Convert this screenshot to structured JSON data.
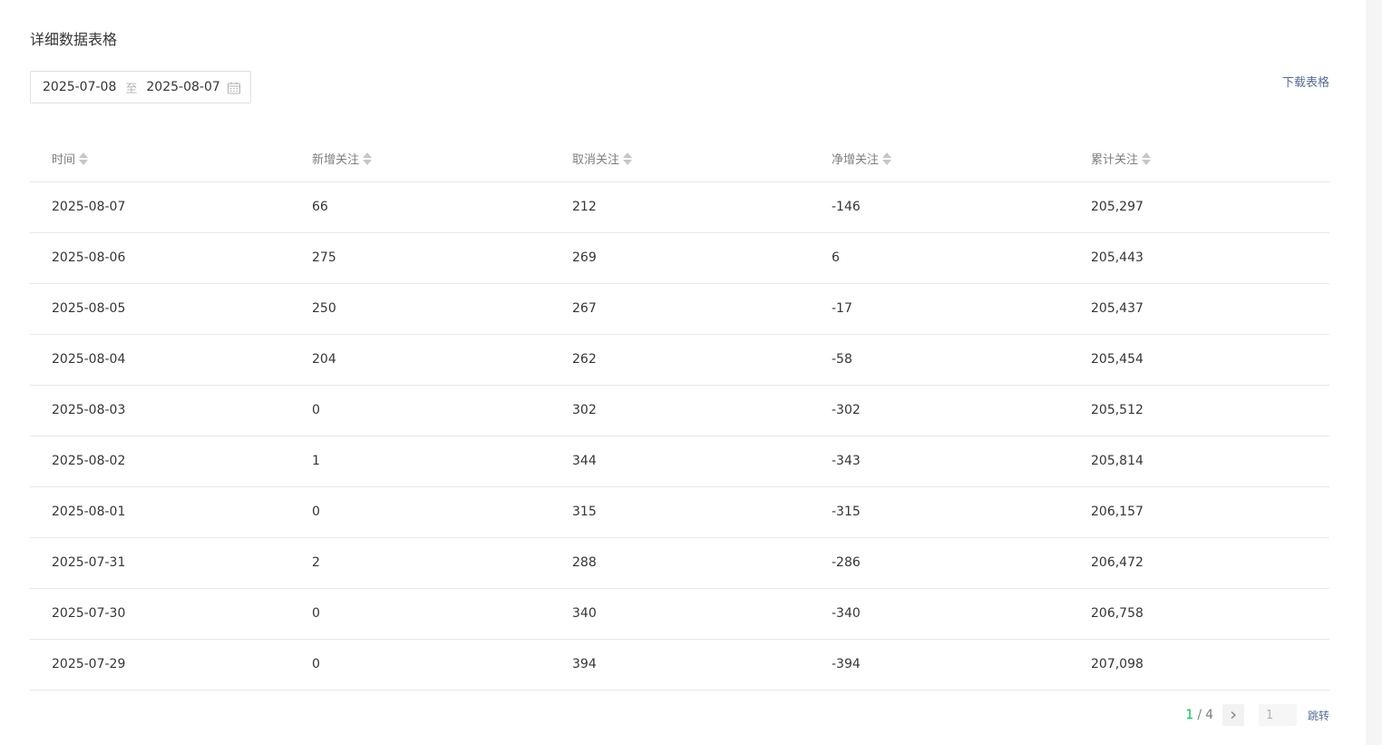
{
  "section": {
    "title": "详细数据表格"
  },
  "date_range": {
    "start": "2025-07-08",
    "separator": "至",
    "end": "2025-08-07"
  },
  "download_label": "下载表格",
  "table": {
    "columns": [
      "时间",
      "新增关注",
      "取消关注",
      "净增关注",
      "累计关注"
    ],
    "rows": [
      [
        "2025-08-07",
        "66",
        "212",
        "-146",
        "205,297"
      ],
      [
        "2025-08-06",
        "275",
        "269",
        "6",
        "205,443"
      ],
      [
        "2025-08-05",
        "250",
        "267",
        "-17",
        "205,437"
      ],
      [
        "2025-08-04",
        "204",
        "262",
        "-58",
        "205,454"
      ],
      [
        "2025-08-03",
        "0",
        "302",
        "-302",
        "205,512"
      ],
      [
        "2025-08-02",
        "1",
        "344",
        "-343",
        "205,814"
      ],
      [
        "2025-08-01",
        "0",
        "315",
        "-315",
        "206,157"
      ],
      [
        "2025-07-31",
        "2",
        "288",
        "-286",
        "206,472"
      ],
      [
        "2025-07-30",
        "0",
        "340",
        "-340",
        "206,758"
      ],
      [
        "2025-07-29",
        "0",
        "394",
        "-394",
        "207,098"
      ]
    ]
  },
  "pagination": {
    "current": "1",
    "separator": "/",
    "total": "4",
    "input_placeholder": "1",
    "jump_label": "跳转"
  },
  "colors": {
    "accent_green": "#07c160",
    "link_blue": "#576b95"
  },
  "icons": {
    "calendar": "calendar-icon",
    "sort": "sort-icon",
    "next": "chevron-right-icon"
  }
}
